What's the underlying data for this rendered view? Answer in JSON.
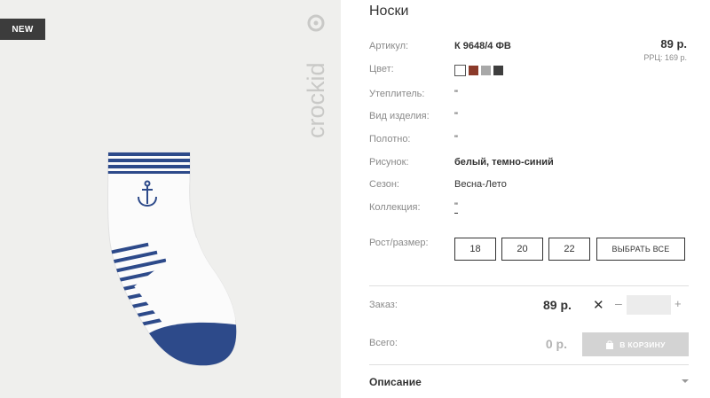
{
  "badge": "NEW",
  "brand": "crockid",
  "product": {
    "title": "Носки",
    "price": "89 р.",
    "rrp": "РРЦ: 169 р."
  },
  "details": {
    "article": {
      "label": "Артикул:",
      "value": "К 9648/4 ФВ"
    },
    "color": {
      "label": "Цвет:"
    },
    "insulation": {
      "label": "Утеплитель:",
      "value": "\""
    },
    "item_type": {
      "label": "Вид изделия:",
      "value": "\""
    },
    "fabric": {
      "label": "Полотно:",
      "value": "\""
    },
    "pattern": {
      "label": "Рисунок:",
      "value": "белый, темно-синий"
    },
    "season": {
      "label": "Сезон:",
      "value": "Весна-Лето"
    },
    "collection": {
      "label": "Коллекция:",
      "value": "\""
    }
  },
  "swatch_colors": [
    "#ffffff",
    "#8b3a2a",
    "#a8a8a8",
    "#3e3e3e"
  ],
  "size": {
    "label": "Рост/размер:",
    "options": [
      "18",
      "20",
      "22"
    ],
    "select_all": "ВЫБРАТЬ ВСЕ"
  },
  "order": {
    "label": "Заказ:",
    "price": "89 р.",
    "times": "✕",
    "minus": "–",
    "plus": "+",
    "quantity": ""
  },
  "total": {
    "label": "Всего:",
    "value": "0 р.",
    "cart_button": "В КОРЗИНУ"
  },
  "description": {
    "label": "Описание"
  },
  "icons": [
    "anchor-icon",
    "times-icon",
    "bag-icon",
    "chevron-down-icon"
  ],
  "colors": {
    "sock_navy": "#2d4a8a",
    "badge_bg": "#3c3c3c",
    "cart_disabled": "#d3d3d3"
  }
}
